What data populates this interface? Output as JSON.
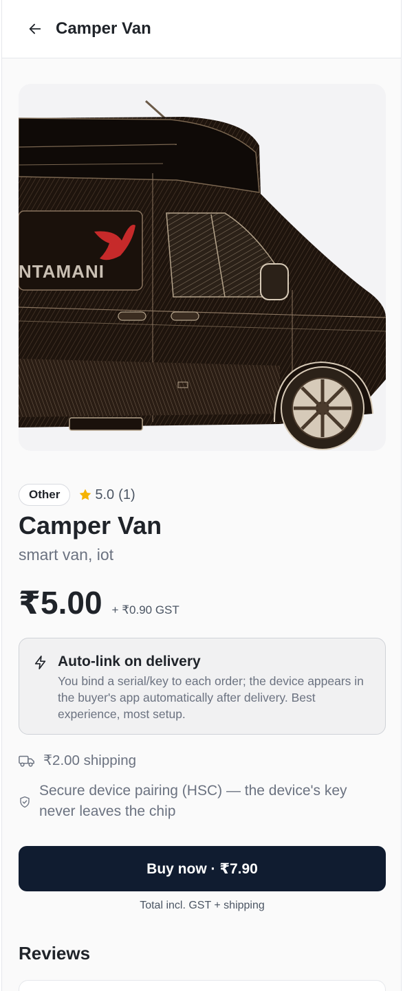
{
  "header": {
    "back_icon": "arrow-left-icon",
    "title": "Camper Van"
  },
  "hero": {
    "brand_text": "NTAMANI",
    "logo_icon": "red-bird-logo"
  },
  "product": {
    "category": "Other",
    "rating_value": "5.0",
    "rating_count": "(1)",
    "title": "Camper Van",
    "tags": "smart van, iot",
    "price": "₹5.00",
    "gst": "+ ₹0.90 GST"
  },
  "feature": {
    "icon": "bolt-icon",
    "title": "Auto-link on delivery",
    "description": "You bind a serial/key to each order; the device appears in the buyer's app automatically after delivery. Best experience, most setup."
  },
  "shipping": {
    "icon": "truck-icon",
    "text": "₹2.00 shipping"
  },
  "security": {
    "icon": "shield-icon",
    "text": "Secure device pairing (HSC) — the device's key never leaves the chip"
  },
  "buy": {
    "label": "Buy now · ₹7.90",
    "note": "Total incl. GST + shipping"
  },
  "reviews": {
    "heading": "Reviews"
  },
  "colors": {
    "accent": "#101c30",
    "star": "#f5b301",
    "brand_red": "#c62a2a"
  }
}
